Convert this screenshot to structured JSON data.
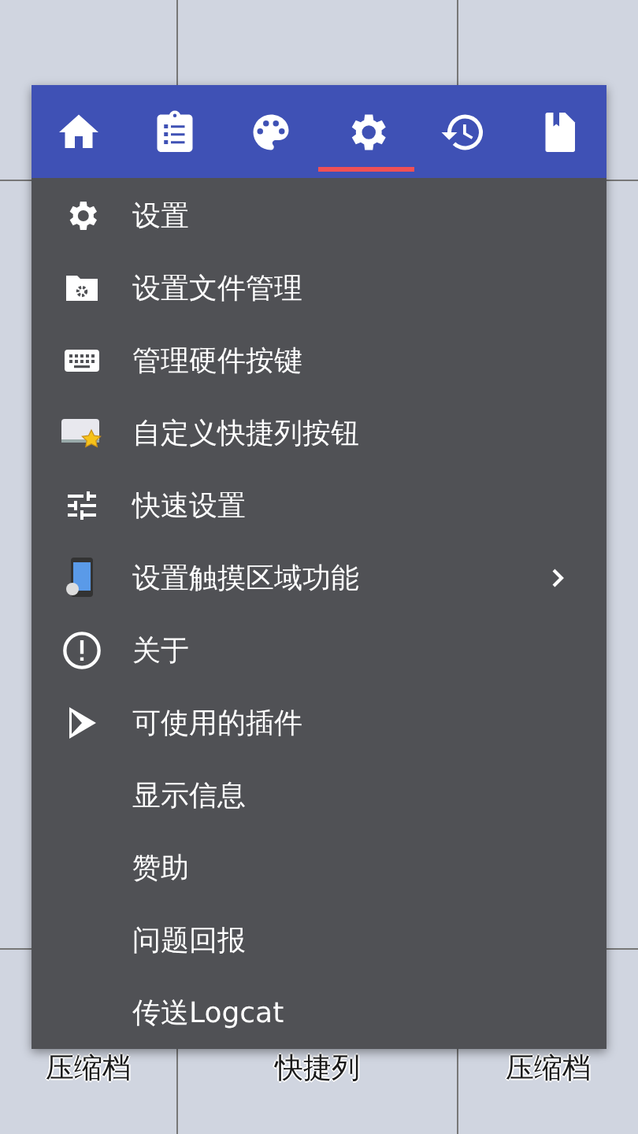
{
  "touch_area_labels": {
    "bottom_left": "压缩档",
    "bottom_center": "快捷列",
    "bottom_right": "压缩档"
  },
  "menu": {
    "tabs": [
      {
        "selected": false
      },
      {
        "selected": false
      },
      {
        "selected": false
      },
      {
        "selected": true
      },
      {
        "selected": false
      },
      {
        "selected": false
      }
    ],
    "items": [
      {
        "label": "设置",
        "has_submenu": false
      },
      {
        "label": "设置文件管理",
        "has_submenu": false
      },
      {
        "label": "管理硬件按键",
        "has_submenu": false
      },
      {
        "label": "自定义快捷列按钮",
        "has_submenu": false
      },
      {
        "label": "快速设置",
        "has_submenu": false
      },
      {
        "label": "设置触摸区域功能",
        "has_submenu": true
      },
      {
        "label": "关于",
        "has_submenu": false
      },
      {
        "label": "可使用的插件",
        "has_submenu": false
      },
      {
        "label": "显示信息",
        "has_submenu": false
      },
      {
        "label": "赞助",
        "has_submenu": false
      },
      {
        "label": "问题回报",
        "has_submenu": false
      },
      {
        "label": "传送Logcat",
        "has_submenu": false
      }
    ]
  }
}
